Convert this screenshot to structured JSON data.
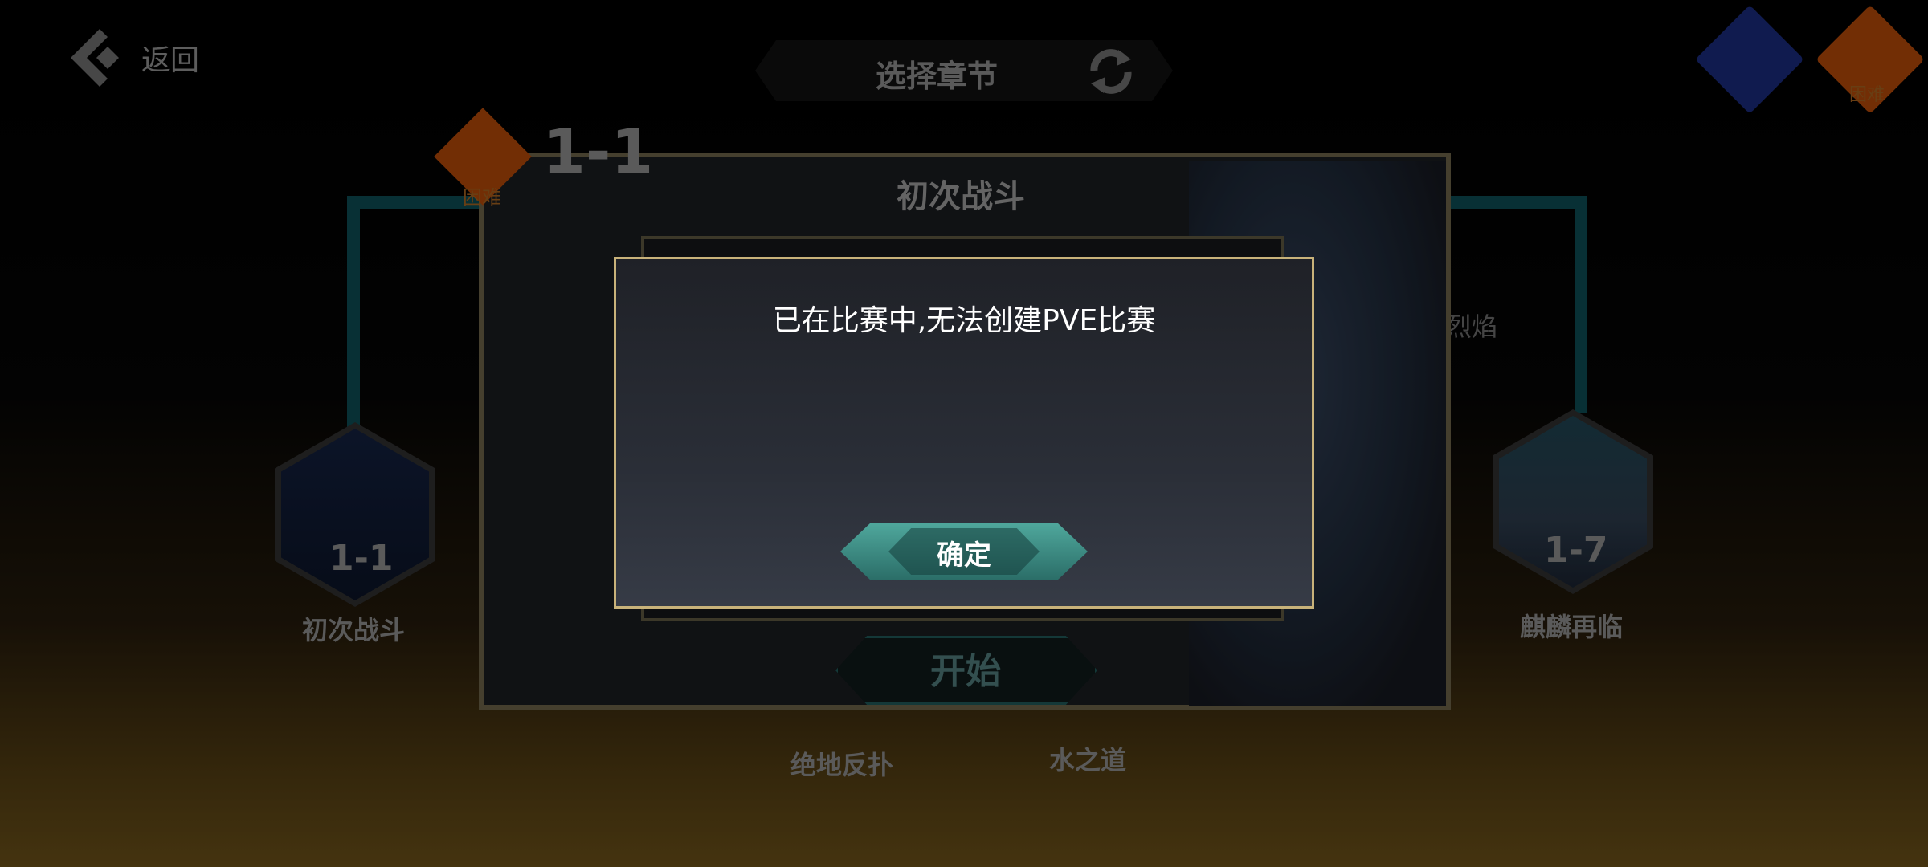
{
  "topbar": {
    "back_label": "返回",
    "title": "选择章节",
    "hard_label": "困难"
  },
  "map": {
    "nodes": [
      {
        "id": "1-1",
        "name": "初次战斗"
      },
      {
        "id": "1-7",
        "name": "麒麟再临"
      }
    ],
    "bottom_names": [
      "绝地反扑",
      "水之道"
    ],
    "partial_text": "烈焰"
  },
  "stage_panel": {
    "badge_label": "困难",
    "stage_id": "1-1",
    "title": "初次战斗",
    "start_label": "开始"
  },
  "dialog": {
    "message": "已在比赛中,无法创建PVE比赛",
    "confirm_label": "确定"
  },
  "colors": {
    "dialog_border": "#c8b27a",
    "confirm_button": "#3f8e86",
    "hard_badge": "#b04808",
    "normal_badge": "#1a2a7a"
  }
}
